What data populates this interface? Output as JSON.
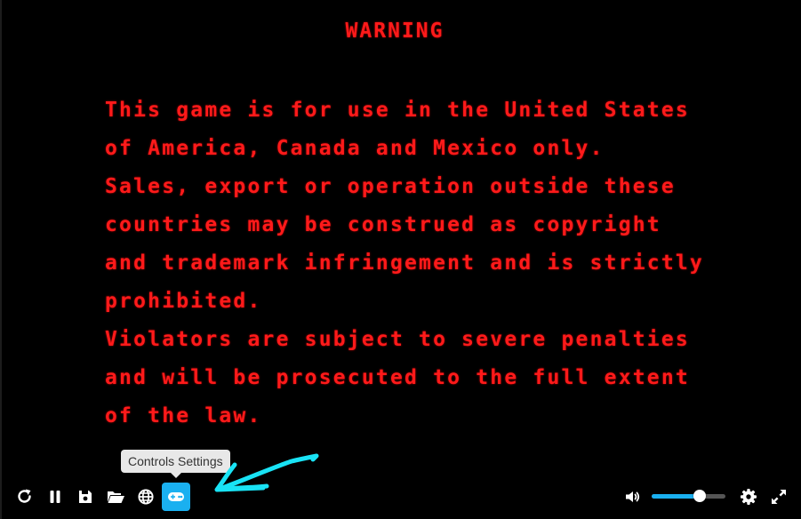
{
  "game_screen": {
    "title": "WARNING",
    "lines": [
      "This game is for use in the United States",
      "of America, Canada and Mexico only.",
      "Sales, export or operation outside these",
      "countries may be construed as copyright",
      "and trademark infringement and is strictly",
      "prohibited.",
      "Violators are subject to severe penalties",
      "and will be prosecuted to the full extent",
      "of the law."
    ],
    "text_color": "#ff1a1a",
    "background_color": "#000000"
  },
  "controls": {
    "left_buttons": [
      {
        "name": "restart",
        "icon": "restart-icon"
      },
      {
        "name": "pause",
        "icon": "pause-icon"
      },
      {
        "name": "save-state",
        "icon": "save-icon"
      },
      {
        "name": "load-state",
        "icon": "folder-open-icon"
      },
      {
        "name": "netplay",
        "icon": "globe-icon"
      },
      {
        "name": "controls-settings",
        "icon": "gamepad-icon",
        "active": true
      }
    ],
    "tooltip": "Controls Settings",
    "volume": {
      "level": 0.65,
      "icon": "volume-icon"
    },
    "right_buttons": [
      {
        "name": "settings",
        "icon": "gear-icon"
      },
      {
        "name": "fullscreen",
        "icon": "fullscreen-icon"
      }
    ],
    "accent_color": "#1ab0f0"
  },
  "annotation": {
    "type": "hand-drawn-arrow",
    "color": "#19e3f5",
    "points_to": "controls-settings"
  }
}
